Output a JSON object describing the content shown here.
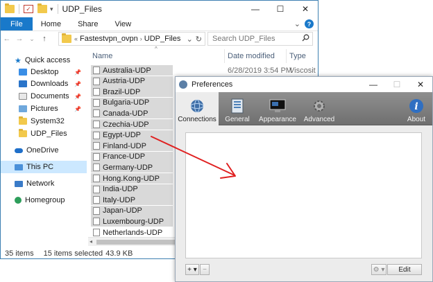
{
  "explorer": {
    "title": "UDP_Files",
    "window_controls": {
      "minimize": "—",
      "maximize": "☐",
      "close": "✕"
    },
    "ribbon": {
      "tabs": [
        "File",
        "Home",
        "Share",
        "View"
      ],
      "expand": "⌄",
      "help": "?"
    },
    "address": {
      "overflow": "«",
      "crumbs": [
        "Fastestvpn_ovpn",
        "UDP_Files"
      ],
      "separator": "›",
      "dropdown": "⌄",
      "refresh": "↻"
    },
    "search": {
      "placeholder": "Search UDP_Files",
      "icon": "search-icon"
    },
    "nav_buttons": {
      "back": "←",
      "forward": "→",
      "recent": "⌄",
      "up": "↑"
    },
    "nav_pane": [
      {
        "label": "Quick access",
        "icon": "star-icon",
        "pinned": false
      },
      {
        "label": "Desktop",
        "icon": "desktop-icon",
        "pinned": true
      },
      {
        "label": "Downloads",
        "icon": "download-icon",
        "pinned": true
      },
      {
        "label": "Documents",
        "icon": "documents-icon",
        "pinned": true
      },
      {
        "label": "Pictures",
        "icon": "pictures-icon",
        "pinned": true
      },
      {
        "label": "System32",
        "icon": "folder-icon",
        "pinned": false
      },
      {
        "label": "UDP_Files",
        "icon": "folder-icon",
        "pinned": false
      },
      {
        "label": "OneDrive",
        "icon": "cloud-icon",
        "pinned": false
      },
      {
        "label": "This PC",
        "icon": "computer-icon",
        "pinned": false
      },
      {
        "label": "Network",
        "icon": "network-icon",
        "pinned": false
      },
      {
        "label": "Homegroup",
        "icon": "homegroup-icon",
        "pinned": false
      }
    ],
    "pin_glyph": "📌",
    "columns": {
      "name": "Name",
      "date": "Date modified",
      "type": "Type"
    },
    "first_row_meta": {
      "date": "6/28/2019 3:54 PM",
      "type": "Viscosit"
    },
    "files": [
      "Australia-UDP",
      "Austria-UDP",
      "Brazil-UDP",
      "Bulgaria-UDP",
      "Canada-UDP",
      "Czechia-UDP",
      "Egypt-UDP",
      "Finland-UDP",
      "France-UDP",
      "Germany-UDP",
      "Hong.Kong-UDP",
      "India-UDP",
      "Italy-UDP",
      "Japan-UDP",
      "Luxembourg-UDP",
      "Netherlands-UDP"
    ],
    "selected_count": 15,
    "status": {
      "items": "35 items",
      "selected": "15 items selected",
      "size": "43.9 KB"
    }
  },
  "preferences": {
    "title": "Preferences",
    "window_controls": {
      "minimize": "—",
      "maximize": "☐",
      "close": "✕"
    },
    "toolbar": [
      {
        "label": "Connections",
        "icon": "connections-icon",
        "active": true
      },
      {
        "label": "General",
        "icon": "general-icon",
        "active": false
      },
      {
        "label": "Appearance",
        "icon": "appearance-icon",
        "active": false
      },
      {
        "label": "Advanced",
        "icon": "gear-icon",
        "active": false
      },
      {
        "label": "About",
        "icon": "info-icon",
        "active": false
      }
    ],
    "add_button": "+ ▾",
    "remove_button": "−",
    "gear_button": "⚙ ▾",
    "edit_button": "Edit"
  },
  "colors": {
    "accent": "#1979ca",
    "selection": "#cce8ff",
    "arrow": "#e02020",
    "toolbar": "#7f7f7f"
  }
}
